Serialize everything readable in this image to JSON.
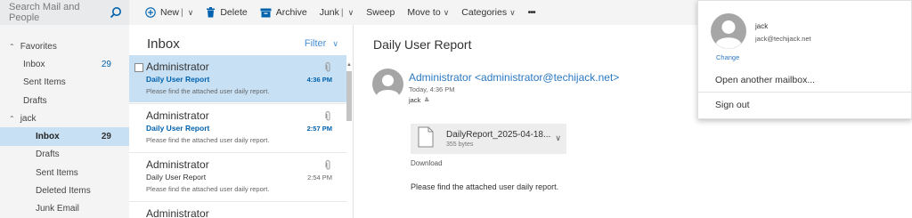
{
  "search": {
    "placeholder": "Search Mail and People",
    "icon": "search-icon"
  },
  "toolbar": {
    "new_label": "New",
    "delete_label": "Delete",
    "archive_label": "Archive",
    "junk_label": "Junk",
    "sweep_label": "Sweep",
    "move_to_label": "Move to",
    "categories_label": "Categories",
    "more_label": "•••"
  },
  "nav": {
    "favorites": {
      "label": "Favorites",
      "items": [
        {
          "label": "Inbox",
          "count": "29"
        },
        {
          "label": "Sent Items",
          "count": ""
        },
        {
          "label": "Drafts",
          "count": ""
        }
      ]
    },
    "account": {
      "label": "jack",
      "items": [
        {
          "label": "Inbox",
          "count": "29"
        },
        {
          "label": "Drafts",
          "count": ""
        },
        {
          "label": "Sent Items",
          "count": ""
        },
        {
          "label": "Deleted Items",
          "count": ""
        },
        {
          "label": "Junk Email",
          "count": ""
        }
      ]
    }
  },
  "list": {
    "title": "Inbox",
    "filter_label": "Filter",
    "messages": [
      {
        "sender": "Administrator",
        "subject": "Daily User Report",
        "time": "4:36 PM",
        "preview": "Please find the attached user daily report."
      },
      {
        "sender": "Administrator",
        "subject": "Daily User Report",
        "time": "2:57 PM",
        "preview": "Please find the attached user daily report."
      },
      {
        "sender": "Administrator",
        "subject": "Daily User Report",
        "time": "2:54 PM",
        "preview": "Please find the attached user daily report."
      },
      {
        "sender": "Administrator"
      }
    ]
  },
  "reading": {
    "subject": "Daily User Report",
    "from": "Administrator <administrator@techijack.net>",
    "date": "Today, 4:36 PM",
    "to": "jack",
    "attachment": {
      "name": "DailyReport_2025-04-18...",
      "size": "355 bytes"
    },
    "download_label": "Download",
    "body": "Please find the attached user daily report."
  },
  "account_popup": {
    "name": "jack",
    "email": "jack@techijack.net",
    "change_label": "Change",
    "open_mailbox_label": "Open another mailbox...",
    "sign_out_label": "Sign out"
  },
  "colors": {
    "accent": "#0062ad",
    "link": "#2b79c2",
    "selection": "#c7e0f4",
    "pane_bg": "#f4f4f4"
  }
}
